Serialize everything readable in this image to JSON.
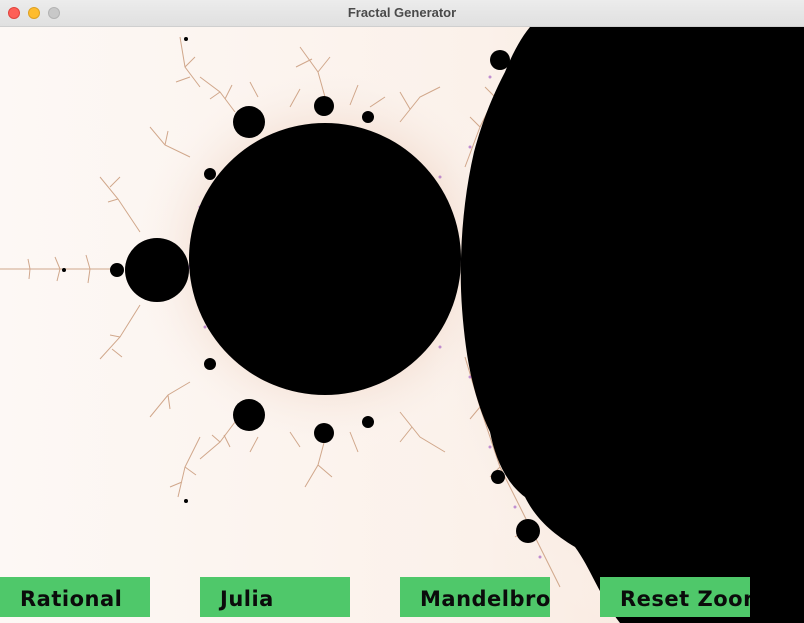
{
  "window": {
    "title": "Fractal Generator"
  },
  "controls": {
    "rational_label": "Rational",
    "julia_label": "Julia",
    "mandelbrot_label": "Mandelbrot",
    "reset_zoom_label": "Reset Zoom"
  },
  "colors": {
    "button_green": "#4fc86a",
    "set_fill": "#000000",
    "background": "#fcf6f2",
    "filament": "#c99a7a",
    "close": "#fe5f57",
    "minimize": "#febc2e"
  },
  "icons": {
    "close": "close-icon",
    "minimize": "minimize-icon",
    "zoom": "zoom-icon"
  }
}
